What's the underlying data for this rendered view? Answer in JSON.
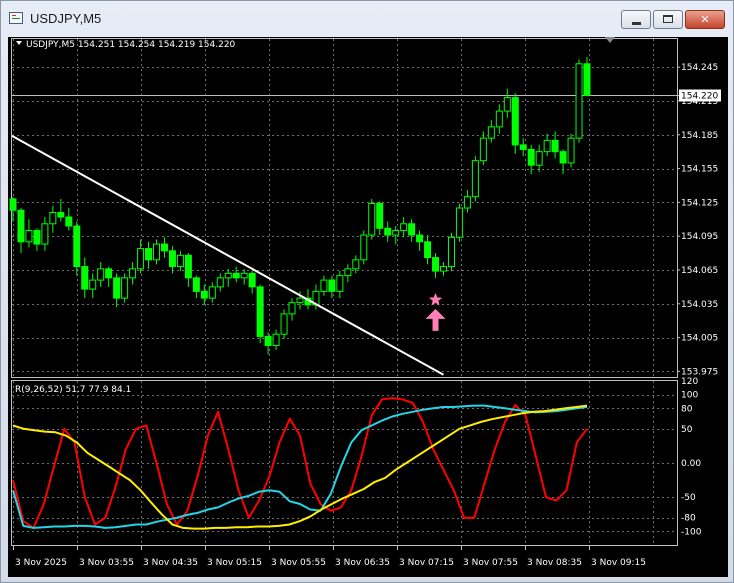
{
  "window": {
    "title": "USDJPY,M5",
    "buttons": {
      "minimize": "minimize",
      "maximize": "maximize",
      "close": "✕"
    }
  },
  "colors": {
    "background": "#000000",
    "grid": "#6e6e6e",
    "candle": "#00ff00",
    "trendline": "#ffffff",
    "marker": "#ff7eb6",
    "ask_line": "#bdbdbd",
    "rsi_red": "#ff0000",
    "rsi_cyan": "#22d6e8",
    "rsi_yellow": "#ffee00",
    "text": "#ffffff"
  },
  "main": {
    "header": "USDJPY,M5  154.251 154.254 154.219 154.220",
    "price_labels": [
      "154.245",
      "154.215",
      "154.185",
      "154.155",
      "154.125",
      "154.095",
      "154.065",
      "154.035",
      "154.005",
      "153.975"
    ],
    "current_price": "154.220"
  },
  "indicator": {
    "header": "R(9,26,52) 51.7 77.9 84.1",
    "scale_labels": [
      "120",
      "100",
      "80",
      "50",
      "0.00",
      "-50",
      "-80",
      "-100"
    ]
  },
  "time_labels": [
    "3 Nov 2025",
    "3 Nov 03:55",
    "3 Nov 04:35",
    "3 Nov 05:15",
    "3 Nov 05:55",
    "3 Nov 06:35",
    "3 Nov 07:15",
    "3 Nov 07:55",
    "3 Nov 08:35",
    "3 Nov 09:15"
  ],
  "icons": {
    "marker_star": "star-icon",
    "marker_arrow": "up-arrow-icon",
    "header_triangle": "dropdown-triangle-icon"
  },
  "chart_data": {
    "type": "candlestick",
    "symbol": "USDJPY",
    "timeframe": "M5",
    "price_range": [
      153.97,
      154.27
    ],
    "ohlc": [
      [
        154.128,
        154.13,
        154.108,
        154.118
      ],
      [
        154.118,
        154.12,
        154.08,
        154.09
      ],
      [
        154.09,
        154.11,
        154.085,
        154.1
      ],
      [
        154.1,
        154.102,
        154.082,
        154.088
      ],
      [
        154.088,
        154.112,
        154.082,
        154.106
      ],
      [
        154.106,
        154.122,
        154.098,
        154.116
      ],
      [
        154.116,
        154.128,
        154.108,
        154.112
      ],
      [
        154.112,
        154.12,
        154.1,
        154.104
      ],
      [
        154.104,
        154.108,
        154.06,
        154.068
      ],
      [
        154.068,
        154.076,
        154.04,
        154.048
      ],
      [
        154.048,
        154.062,
        154.04,
        154.056
      ],
      [
        154.056,
        154.072,
        154.05,
        154.066
      ],
      [
        154.066,
        154.068,
        154.05,
        154.058
      ],
      [
        154.058,
        154.062,
        154.032,
        154.04
      ],
      [
        154.04,
        154.062,
        154.036,
        154.058
      ],
      [
        154.058,
        154.072,
        154.052,
        154.066
      ],
      [
        154.066,
        154.092,
        154.062,
        154.084
      ],
      [
        154.084,
        154.09,
        154.066,
        154.074
      ],
      [
        154.074,
        154.092,
        154.07,
        154.088
      ],
      [
        154.088,
        154.094,
        154.076,
        154.082
      ],
      [
        154.082,
        154.086,
        154.062,
        154.068
      ],
      [
        154.068,
        154.082,
        154.064,
        154.078
      ],
      [
        154.078,
        154.08,
        154.05,
        154.058
      ],
      [
        154.058,
        154.06,
        154.04,
        154.046
      ],
      [
        154.046,
        154.052,
        154.034,
        154.04
      ],
      [
        154.04,
        154.054,
        154.036,
        154.05
      ],
      [
        154.05,
        154.062,
        154.046,
        154.058
      ],
      [
        154.058,
        154.066,
        154.05,
        154.062
      ],
      [
        154.062,
        154.068,
        154.054,
        154.058
      ],
      [
        154.058,
        154.066,
        154.052,
        154.062
      ],
      [
        154.062,
        154.064,
        154.044,
        154.05
      ],
      [
        154.05,
        154.052,
        154.0,
        154.006
      ],
      [
        154.006,
        154.01,
        153.99,
        153.998
      ],
      [
        153.998,
        154.012,
        153.994,
        154.008
      ],
      [
        154.008,
        154.03,
        154.004,
        154.026
      ],
      [
        154.026,
        154.04,
        154.02,
        154.036
      ],
      [
        154.036,
        154.046,
        154.03,
        154.04
      ],
      [
        154.04,
        154.048,
        154.03,
        154.034
      ],
      [
        154.034,
        154.052,
        154.03,
        154.046
      ],
      [
        154.046,
        154.06,
        154.042,
        154.056
      ],
      [
        154.056,
        154.06,
        154.04,
        154.046
      ],
      [
        154.046,
        154.064,
        154.04,
        154.06
      ],
      [
        154.06,
        154.07,
        154.054,
        154.066
      ],
      [
        154.066,
        154.078,
        154.062,
        154.074
      ],
      [
        154.074,
        154.1,
        154.07,
        154.096
      ],
      [
        154.096,
        154.128,
        154.092,
        154.124
      ],
      [
        154.124,
        154.126,
        154.096,
        154.102
      ],
      [
        154.102,
        154.108,
        154.09,
        154.096
      ],
      [
        154.096,
        154.104,
        154.088,
        154.1
      ],
      [
        154.1,
        154.112,
        154.094,
        154.106
      ],
      [
        154.106,
        154.11,
        154.09,
        154.096
      ],
      [
        154.096,
        154.1,
        154.082,
        154.09
      ],
      [
        154.09,
        154.096,
        154.07,
        154.076
      ],
      [
        154.076,
        154.08,
        154.058,
        154.064
      ],
      [
        154.064,
        154.072,
        154.06,
        154.068
      ],
      [
        154.068,
        154.098,
        154.064,
        154.094
      ],
      [
        154.094,
        154.124,
        154.09,
        154.12
      ],
      [
        154.12,
        154.136,
        154.116,
        154.13
      ],
      [
        154.13,
        154.166,
        154.126,
        154.162
      ],
      [
        154.162,
        154.188,
        154.158,
        154.182
      ],
      [
        154.182,
        154.198,
        154.178,
        154.192
      ],
      [
        154.192,
        154.212,
        154.186,
        154.206
      ],
      [
        154.206,
        154.226,
        154.2,
        154.218
      ],
      [
        154.218,
        154.222,
        154.168,
        154.176
      ],
      [
        154.176,
        154.182,
        154.166,
        154.172
      ],
      [
        154.172,
        154.176,
        154.15,
        154.158
      ],
      [
        154.158,
        154.176,
        154.152,
        154.17
      ],
      [
        154.17,
        154.186,
        154.166,
        154.18
      ],
      [
        154.18,
        154.188,
        154.164,
        154.17
      ],
      [
        154.17,
        154.172,
        154.15,
        154.16
      ],
      [
        154.16,
        154.186,
        154.156,
        154.182
      ],
      [
        154.182,
        154.252,
        154.178,
        154.248
      ],
      [
        154.248,
        154.254,
        154.219,
        154.22
      ]
    ],
    "trendline": {
      "from": [
        0,
        154.184
      ],
      "to": [
        54,
        153.972
      ]
    },
    "marker_bar": 53,
    "rsi": {
      "range": [
        -120,
        120
      ],
      "series": [
        {
          "color": "#ff0000",
          "values": [
            -25,
            -85,
            -95,
            -60,
            -5,
            50,
            30,
            -50,
            -90,
            -80,
            -35,
            20,
            50,
            55,
            0,
            -60,
            -90,
            -70,
            -20,
            40,
            75,
            20,
            -40,
            -80,
            -55,
            -20,
            30,
            65,
            40,
            -30,
            -60,
            -70,
            -65,
            -40,
            10,
            70,
            93,
            95,
            93,
            88,
            60,
            20,
            -10,
            -40,
            -80,
            -80,
            -30,
            20,
            60,
            85,
            70,
            10,
            -50,
            -55,
            -40,
            30,
            50
          ]
        },
        {
          "color": "#22d6e8",
          "values": [
            -40,
            -92,
            -95,
            -94,
            -93,
            -93,
            -92,
            -92,
            -93,
            -95,
            -94,
            -92,
            -90,
            -90,
            -86,
            -83,
            -80,
            -76,
            -73,
            -68,
            -65,
            -58,
            -52,
            -48,
            -42,
            -40,
            -42,
            -56,
            -60,
            -68,
            -70,
            -45,
            -5,
            30,
            48,
            55,
            62,
            68,
            72,
            75,
            78,
            80,
            82,
            82,
            83,
            84,
            84,
            82,
            80,
            78,
            76,
            74,
            75,
            76,
            78,
            80,
            82
          ]
        },
        {
          "color": "#ffee00",
          "values": [
            55,
            50,
            48,
            46,
            45,
            40,
            30,
            15,
            5,
            -5,
            -15,
            -25,
            -40,
            -58,
            -75,
            -90,
            -95,
            -96,
            -96,
            -95,
            -95,
            -94,
            -94,
            -93,
            -93,
            -92,
            -90,
            -85,
            -78,
            -68,
            -60,
            -52,
            -45,
            -38,
            -28,
            -22,
            -10,
            0,
            10,
            20,
            30,
            40,
            50,
            55,
            60,
            64,
            67,
            70,
            73,
            75,
            76,
            78,
            80,
            82,
            84
          ]
        }
      ]
    }
  }
}
